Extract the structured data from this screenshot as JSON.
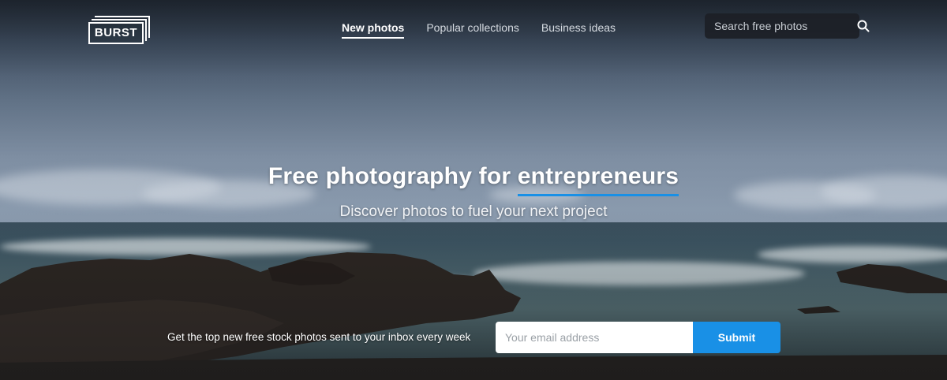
{
  "brand": {
    "logo_text": "BURST"
  },
  "nav": {
    "items": [
      {
        "label": "New photos",
        "active": true
      },
      {
        "label": "Popular collections",
        "active": false
      },
      {
        "label": "Business ideas",
        "active": false
      }
    ]
  },
  "search": {
    "placeholder": "Search free photos",
    "icon": "search-icon"
  },
  "hero": {
    "headline_prefix": "Free photography for",
    "headline_highlight": "entrepreneurs",
    "subheadline": "Discover photos to fuel your next project"
  },
  "newsletter": {
    "text": "Get the top new free stock photos sent to your inbox every week",
    "email_placeholder": "Your email address",
    "submit_label": "Submit"
  },
  "colors": {
    "accent": "#1990e6",
    "search_bg": "#1c2026"
  }
}
